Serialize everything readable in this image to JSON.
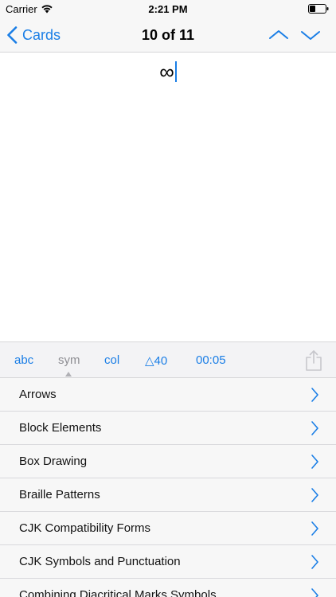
{
  "status_bar": {
    "carrier": "Carrier",
    "time": "2:21 PM"
  },
  "nav": {
    "back_label": "Cards",
    "title": "10 of 11"
  },
  "card": {
    "text": "∞"
  },
  "toolbar": {
    "abc": "abc",
    "sym": "sym",
    "col": "col",
    "delta": "△40",
    "time": "00:05"
  },
  "symbol_list": {
    "items": [
      {
        "label": "Arrows"
      },
      {
        "label": "Block Elements"
      },
      {
        "label": "Box Drawing"
      },
      {
        "label": "Braille Patterns"
      },
      {
        "label": "CJK Compatibility Forms"
      },
      {
        "label": "CJK Symbols and Punctuation"
      },
      {
        "label": "Combining Diacritical Marks Symbols"
      }
    ]
  },
  "colors": {
    "accent": "#1a7ee6",
    "bar_background": "#f7f7f7",
    "separator": "#d6d6d8",
    "inactive": "#8e8e93"
  }
}
